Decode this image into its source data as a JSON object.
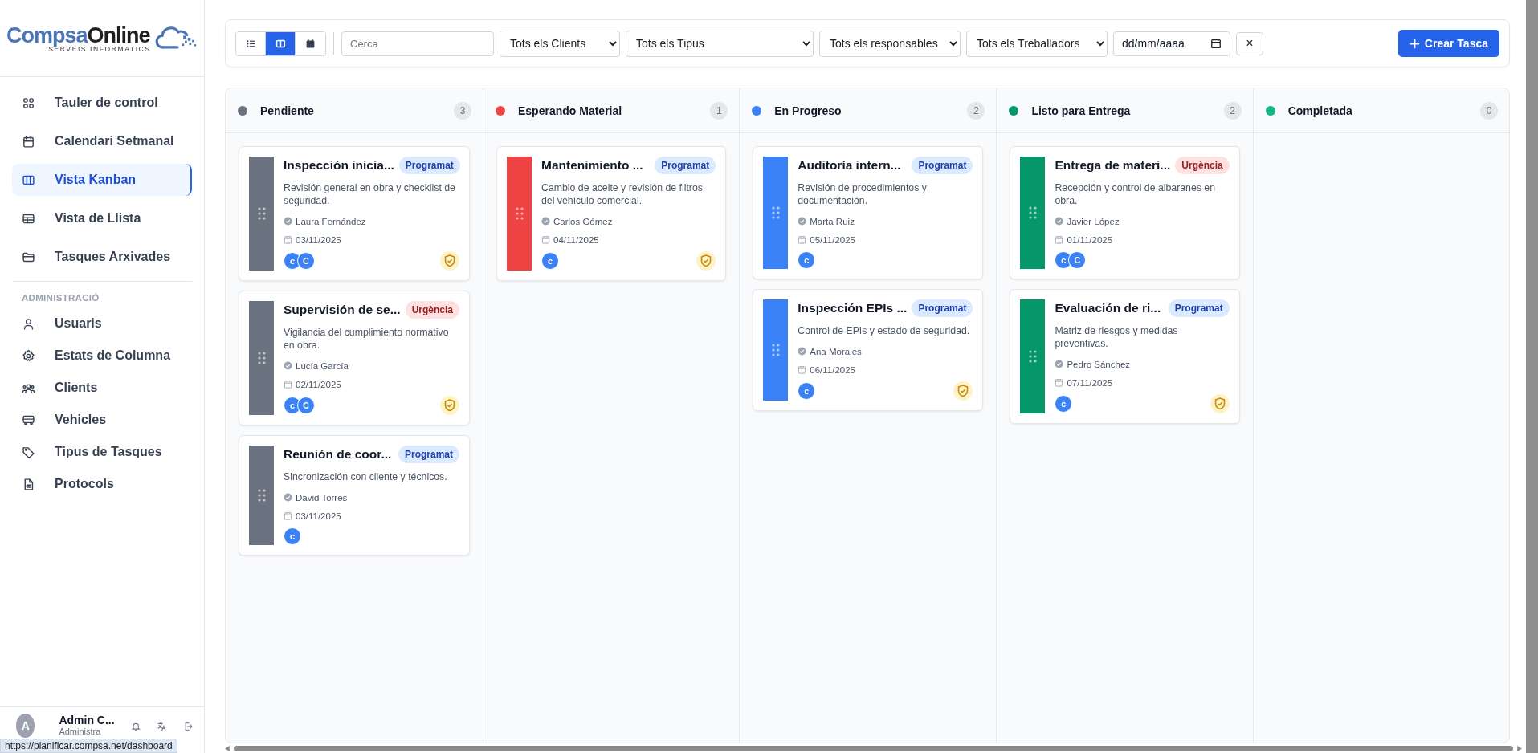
{
  "brand": {
    "name_part1": "Compsa",
    "name_part2": "Online",
    "tagline": "SERVEIS INFORMATICS"
  },
  "sidebar": {
    "items": [
      {
        "label": "Tauler de control",
        "selected": false
      },
      {
        "label": "Calendari Setmanal",
        "selected": false
      },
      {
        "label": "Vista Kanban",
        "selected": true
      },
      {
        "label": "Vista de Llista",
        "selected": false
      },
      {
        "label": "Tasques Arxivades",
        "selected": false
      }
    ],
    "section_title": "ADMINISTRACIÓ",
    "admin_items": [
      {
        "label": "Usuaris",
        "selected": false
      },
      {
        "label": "Estats de Columna",
        "selected": false
      },
      {
        "label": "Clients",
        "selected": false
      },
      {
        "label": "Vehicles",
        "selected": false
      },
      {
        "label": "Tipus de Tasques",
        "selected": false
      },
      {
        "label": "Protocols",
        "selected": false
      }
    ],
    "user": {
      "initial": "A",
      "name": "Admin C...",
      "role": "Administra"
    }
  },
  "status_url": "https://planificar.compsa.net/dashboard",
  "toolbar": {
    "view_buttons": [
      {
        "selected": false
      },
      {
        "selected": true
      },
      {
        "selected": false
      }
    ],
    "search": {
      "placeholder": "Cerca"
    },
    "filters": [
      "Tots els Clients",
      "Tots els Tipus",
      "Tots els responsables",
      "Tots els Treballadors"
    ],
    "date": {
      "placeholder": "dd/mm/aaaa"
    },
    "clear": "×",
    "create_button": "Crear Tasca"
  },
  "columns": [
    {
      "name": "Pendiente",
      "color": "#6b7280",
      "count": "3",
      "cards": [
        {
          "title": "Inspección inicia...",
          "badge": {
            "label": "Programat",
            "kind": "scheduled"
          },
          "description": "Revisión general en obra y checklist de seguridad.",
          "person": "Laura Fernández",
          "date": "03/11/2025",
          "avatars": [
            "c",
            "C"
          ],
          "shield": true
        },
        {
          "title": "Supervisión de se...",
          "badge": {
            "label": "Urgència",
            "kind": "urgent"
          },
          "description": "Vigilancia del cumplimiento normativo en obra.",
          "person": "Lucía García",
          "date": "02/11/2025",
          "avatars": [
            "c",
            "C"
          ],
          "shield": true
        },
        {
          "title": "Reunión de coor...",
          "badge": {
            "label": "Programat",
            "kind": "scheduled"
          },
          "description": "Sincronización con cliente y técnicos.",
          "person": "David Torres",
          "date": "03/11/2025",
          "avatars": [
            "c"
          ],
          "shield": false
        }
      ]
    },
    {
      "name": "Esperando Material",
      "color": "#ef4444",
      "count": "1",
      "cards": [
        {
          "title": "Mantenimiento ...",
          "badge": {
            "label": "Programat",
            "kind": "scheduled"
          },
          "description": "Cambio de aceite y revisión de filtros del vehículo comercial.",
          "person": "Carlos Gómez",
          "date": "04/11/2025",
          "avatars": [
            "c"
          ],
          "shield": true
        }
      ]
    },
    {
      "name": "En Progreso",
      "color": "#3b82f6",
      "count": "2",
      "cards": [
        {
          "title": "Auditoría intern...",
          "badge": {
            "label": "Programat",
            "kind": "scheduled"
          },
          "description": "Revisión de procedimientos y documentación.",
          "person": "Marta Ruiz",
          "date": "05/11/2025",
          "avatars": [
            "c"
          ],
          "shield": false
        },
        {
          "title": "Inspección EPIs ...",
          "badge": {
            "label": "Programat",
            "kind": "scheduled"
          },
          "description": "Control de EPIs y estado de seguridad.",
          "person": "Ana Morales",
          "date": "06/11/2025",
          "avatars": [
            "c"
          ],
          "shield": true
        }
      ]
    },
    {
      "name": "Listo para Entrega",
      "color": "#059669",
      "count": "2",
      "cards": [
        {
          "title": "Entrega de materi...",
          "badge": {
            "label": "Urgència",
            "kind": "urgent"
          },
          "description": "Recepción y control de albaranes en obra.",
          "person": "Javier López",
          "date": "01/11/2025",
          "avatars": [
            "c",
            "C"
          ],
          "shield": false
        },
        {
          "title": "Evaluación de ri...",
          "badge": {
            "label": "Programat",
            "kind": "scheduled"
          },
          "description": "Matriz de riesgos y medidas preventivas.",
          "person": "Pedro Sánchez",
          "date": "07/11/2025",
          "avatars": [
            "c"
          ],
          "shield": true
        }
      ]
    },
    {
      "name": "Completada",
      "color": "#10b981",
      "count": "0"
    }
  ]
}
